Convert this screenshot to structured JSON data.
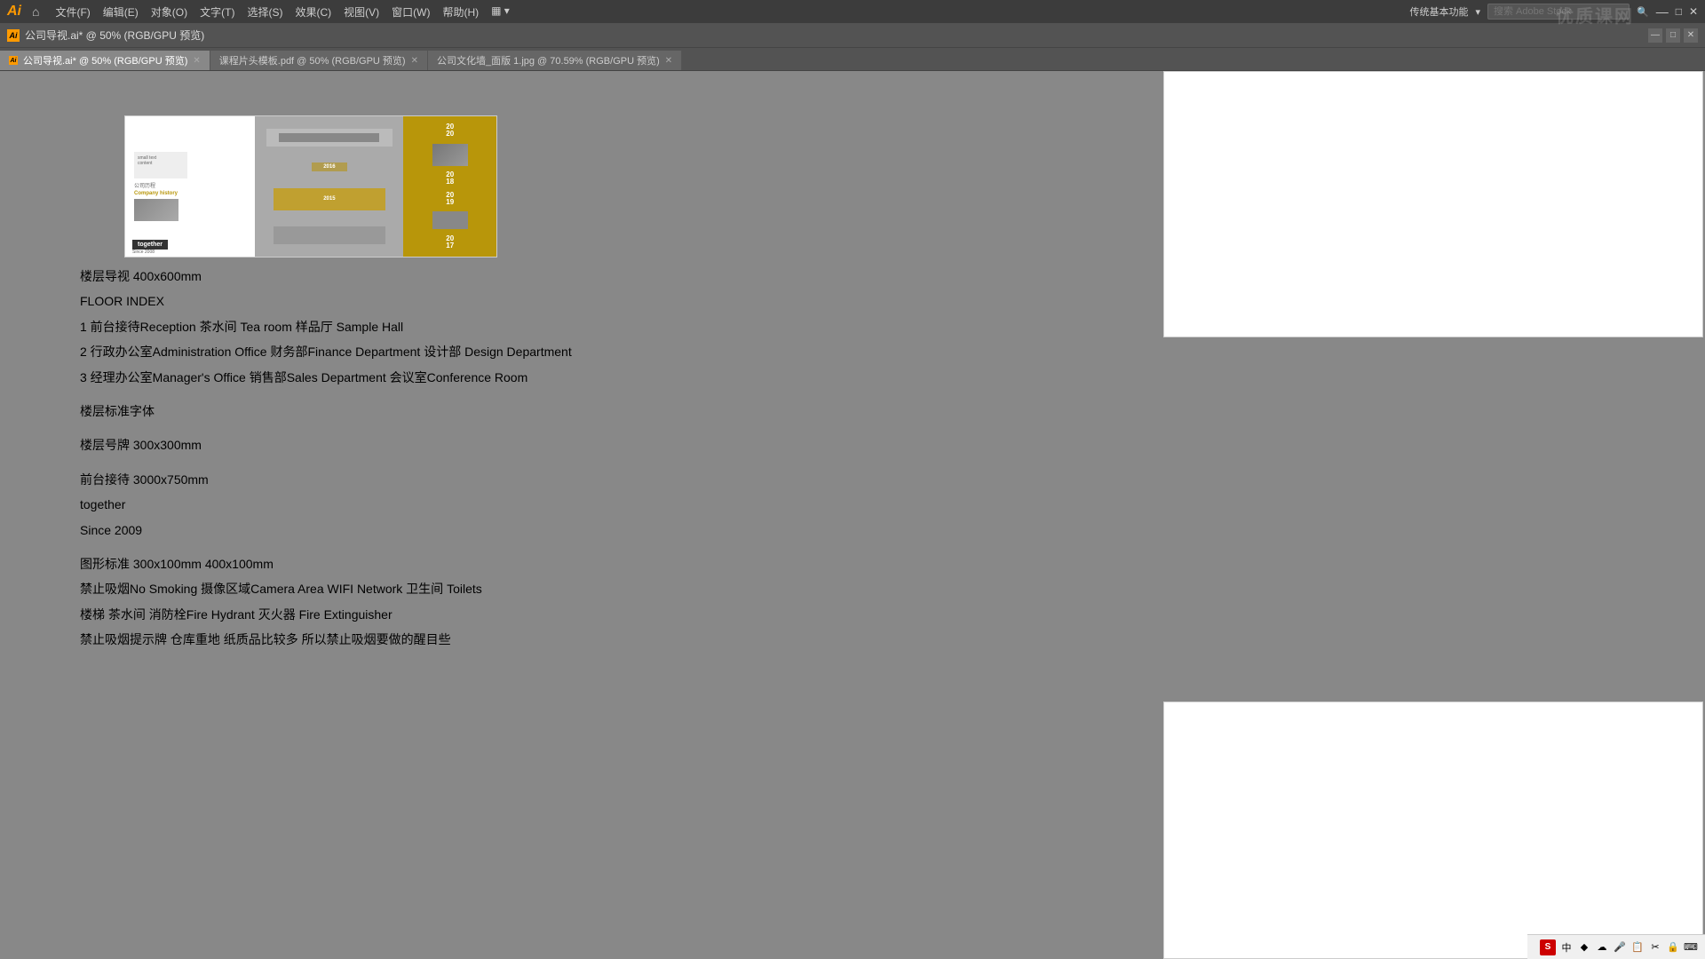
{
  "app": {
    "logo": "Ai",
    "title": "公司导视.ai* @ 50% (RGB/GPU 预览)",
    "title_icon": "Ai"
  },
  "menu": {
    "items": [
      "文件(F)",
      "编辑(E)",
      "对象(O)",
      "文字(T)",
      "选择(S)",
      "效果(C)",
      "视图(V)",
      "窗口(W)",
      "帮助(H)"
    ],
    "right_label": "传统基本功能",
    "search_placeholder": "搜索 Adobe Stock"
  },
  "tabs": [
    {
      "label": "公司导视.ai* @ 50% (RGB/GPU 预览)",
      "active": true,
      "icon": "Ai"
    },
    {
      "label": "课程片头模板.pdf @ 50% (RGB/GPU 预览)",
      "active": false
    },
    {
      "label": "公司文化墙_面版 1.jpg @ 70.59% (RGB/GPU 预览)",
      "active": false
    }
  ],
  "preview": {
    "company_history_cn": "公司历程",
    "company_history_en": "Company history",
    "together": "together",
    "since": "Since 2008",
    "years": [
      "20\n20",
      "20\n16",
      "20\n18",
      "20\n19",
      "20\n17"
    ]
  },
  "text_content": {
    "section1_title": "楼层导视 400x600mm",
    "section1_sub": "FLOOR INDEX",
    "floor1": "1  前台接待Reception  茶水间 Tea room 样品厅 Sample Hall",
    "floor2": "2 行政办公室Administration Office 财务部Finance Department 设计部 Design Department",
    "floor3": "3 经理办公室Manager's Office 销售部Sales Department 会议室Conference Room",
    "section2_title": "楼层标准字体",
    "section3_title": "楼层号牌 300x300mm",
    "section4_title": "前台接待 3000x750mm",
    "together_text": "together",
    "since_text": "Since 2009",
    "section5_title": "图形标准 300x100mm  400x100mm",
    "signs_line1": "禁止吸烟No Smoking 摄像区域Camera Area WIFI Network 卫生间 Toilets",
    "signs_line2": "楼梯 茶水间 消防栓Fire Hydrant 灭火器 Fire Extinguisher",
    "signs_line3": "禁止吸烟提示牌 仓库重地 纸质品比较多 所以禁止吸烟要做的醒目些"
  },
  "tray": {
    "icons": [
      "S",
      "中",
      "♦",
      "☁",
      "🎤",
      "📋",
      "✂",
      "🔒",
      "⌨"
    ]
  }
}
